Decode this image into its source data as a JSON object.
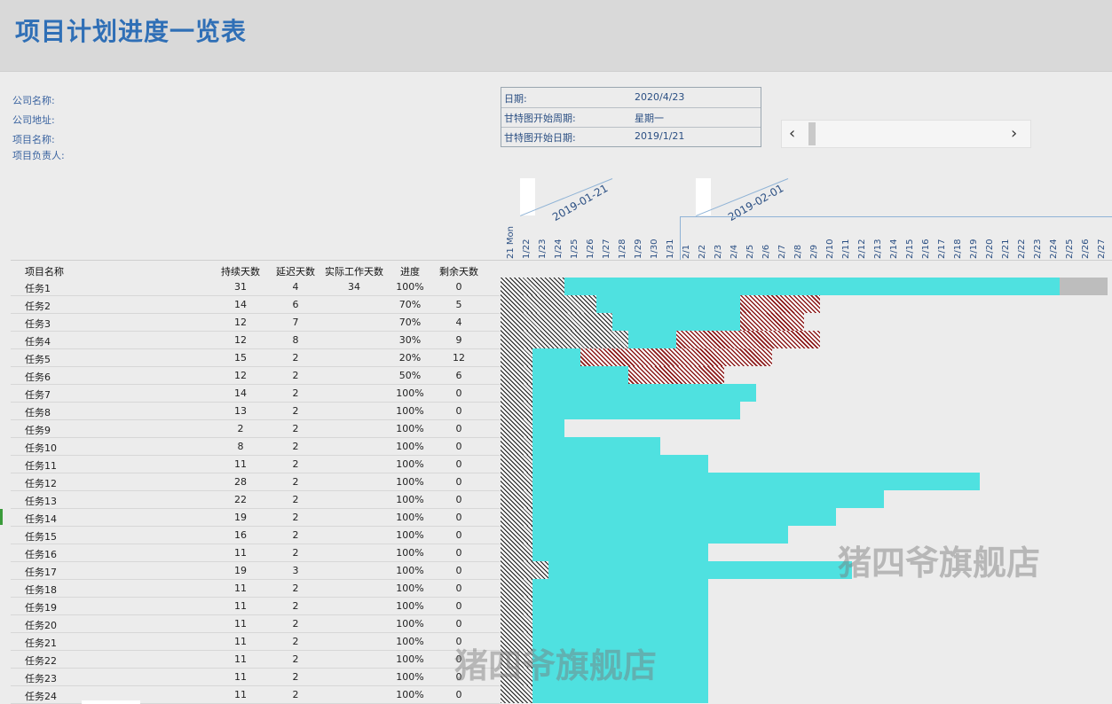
{
  "title": "项目计划进度一览表",
  "info": {
    "company_name_label": "公司名称:",
    "company_address_label": "公司地址:",
    "project_name_label": "项目名称:",
    "project_owner_label": "项目负责人:",
    "date_label": "日期:",
    "date_value": "2020/4/23",
    "gantt_start_week_label": "甘特图开始周期:",
    "gantt_start_week_value": "星期一",
    "gantt_start_date_label": "甘特图开始日期:",
    "gantt_start_date_value": "2019/1/21"
  },
  "scroller": {
    "prev_icon": "chevron-left-icon",
    "next_icon": "chevron-right-icon"
  },
  "months": [
    "2019-01-21",
    "2019-02-01"
  ],
  "days": [
    "21 Mon",
    "1/22",
    "1/23",
    "1/24",
    "1/25",
    "1/26",
    "1/27",
    "1/28",
    "1/29",
    "1/30",
    "1/31",
    "2/1",
    "2/2",
    "2/3",
    "2/4",
    "2/5",
    "2/6",
    "2/7",
    "2/8",
    "2/9",
    "2/10",
    "2/11",
    "2/12",
    "2/13",
    "2/14",
    "2/15",
    "2/16",
    "2/17",
    "2/18",
    "2/19",
    "2/20",
    "2/21",
    "2/22",
    "2/23",
    "2/24",
    "2/25",
    "2/26",
    "2/27"
  ],
  "columns": {
    "name": "项目名称",
    "duration": "持续天数",
    "delay": "延迟天数",
    "actual": "实际工作天数",
    "progress": "进度",
    "remaining": "剩余天数"
  },
  "tasks": [
    {
      "name": "任务1",
      "duration": "31",
      "delay": "4",
      "actual": "34",
      "progress": "100%",
      "remaining": "0"
    },
    {
      "name": "任务2",
      "duration": "14",
      "delay": "6",
      "actual": "",
      "progress": "70%",
      "remaining": "5"
    },
    {
      "name": "任务3",
      "duration": "12",
      "delay": "7",
      "actual": "",
      "progress": "70%",
      "remaining": "4"
    },
    {
      "name": "任务4",
      "duration": "12",
      "delay": "8",
      "actual": "",
      "progress": "30%",
      "remaining": "9"
    },
    {
      "name": "任务5",
      "duration": "15",
      "delay": "2",
      "actual": "",
      "progress": "20%",
      "remaining": "12"
    },
    {
      "name": "任务6",
      "duration": "12",
      "delay": "2",
      "actual": "",
      "progress": "50%",
      "remaining": "6"
    },
    {
      "name": "任务7",
      "duration": "14",
      "delay": "2",
      "actual": "",
      "progress": "100%",
      "remaining": "0"
    },
    {
      "name": "任务8",
      "duration": "13",
      "delay": "2",
      "actual": "",
      "progress": "100%",
      "remaining": "0"
    },
    {
      "name": "任务9",
      "duration": "2",
      "delay": "2",
      "actual": "",
      "progress": "100%",
      "remaining": "0"
    },
    {
      "name": "任务10",
      "duration": "8",
      "delay": "2",
      "actual": "",
      "progress": "100%",
      "remaining": "0"
    },
    {
      "name": "任务11",
      "duration": "11",
      "delay": "2",
      "actual": "",
      "progress": "100%",
      "remaining": "0"
    },
    {
      "name": "任务12",
      "duration": "28",
      "delay": "2",
      "actual": "",
      "progress": "100%",
      "remaining": "0"
    },
    {
      "name": "任务13",
      "duration": "22",
      "delay": "2",
      "actual": "",
      "progress": "100%",
      "remaining": "0"
    },
    {
      "name": "任务14",
      "duration": "19",
      "delay": "2",
      "actual": "",
      "progress": "100%",
      "remaining": "0"
    },
    {
      "name": "任务15",
      "duration": "16",
      "delay": "2",
      "actual": "",
      "progress": "100%",
      "remaining": "0"
    },
    {
      "name": "任务16",
      "duration": "11",
      "delay": "2",
      "actual": "",
      "progress": "100%",
      "remaining": "0"
    },
    {
      "name": "任务17",
      "duration": "19",
      "delay": "3",
      "actual": "",
      "progress": "100%",
      "remaining": "0"
    },
    {
      "name": "任务18",
      "duration": "11",
      "delay": "2",
      "actual": "",
      "progress": "100%",
      "remaining": "0"
    },
    {
      "name": "任务19",
      "duration": "11",
      "delay": "2",
      "actual": "",
      "progress": "100%",
      "remaining": "0"
    },
    {
      "name": "任务20",
      "duration": "11",
      "delay": "2",
      "actual": "",
      "progress": "100%",
      "remaining": "0"
    },
    {
      "name": "任务21",
      "duration": "11",
      "delay": "2",
      "actual": "",
      "progress": "100%",
      "remaining": "0"
    },
    {
      "name": "任务22",
      "duration": "11",
      "delay": "2",
      "actual": "",
      "progress": "100%",
      "remaining": "0"
    },
    {
      "name": "任务23",
      "duration": "11",
      "delay": "2",
      "actual": "",
      "progress": "100%",
      "remaining": "0"
    },
    {
      "name": "任务24",
      "duration": "11",
      "delay": "2",
      "actual": "",
      "progress": "100%",
      "remaining": "0"
    }
  ],
  "gantt": [
    {
      "hatch_days": 4,
      "done_days": 31,
      "delay_days": 0,
      "grey_days": 3
    },
    {
      "hatch_days": 6,
      "done_days": 9,
      "delay_days": 5,
      "grey_days": 0
    },
    {
      "hatch_days": 7,
      "done_days": 8,
      "delay_days": 4,
      "grey_days": 0
    },
    {
      "hatch_days": 8,
      "done_days": 3,
      "delay_days": 9,
      "grey_days": 0
    },
    {
      "hatch_days": 2,
      "done_days": 3,
      "delay_days": 12,
      "grey_days": 0
    },
    {
      "hatch_days": 2,
      "done_days": 6,
      "delay_days": 6,
      "grey_days": 0
    },
    {
      "hatch_days": 2,
      "done_days": 14,
      "delay_days": 0,
      "grey_days": 0
    },
    {
      "hatch_days": 2,
      "done_days": 13,
      "delay_days": 0,
      "grey_days": 0
    },
    {
      "hatch_days": 2,
      "done_days": 2,
      "delay_days": 0,
      "grey_days": 0
    },
    {
      "hatch_days": 2,
      "done_days": 8,
      "delay_days": 0,
      "grey_days": 0
    },
    {
      "hatch_days": 2,
      "done_days": 11,
      "delay_days": 0,
      "grey_days": 0
    },
    {
      "hatch_days": 2,
      "done_days": 28,
      "delay_days": 0,
      "grey_days": 0
    },
    {
      "hatch_days": 2,
      "done_days": 22,
      "delay_days": 0,
      "grey_days": 0
    },
    {
      "hatch_days": 2,
      "done_days": 19,
      "delay_days": 0,
      "grey_days": 0
    },
    {
      "hatch_days": 2,
      "done_days": 16,
      "delay_days": 0,
      "grey_days": 0
    },
    {
      "hatch_days": 2,
      "done_days": 11,
      "delay_days": 0,
      "grey_days": 0
    },
    {
      "hatch_days": 3,
      "done_days": 19,
      "delay_days": 0,
      "grey_days": 0
    },
    {
      "hatch_days": 2,
      "done_days": 11,
      "delay_days": 0,
      "grey_days": 0
    },
    {
      "hatch_days": 2,
      "done_days": 11,
      "delay_days": 0,
      "grey_days": 0
    },
    {
      "hatch_days": 2,
      "done_days": 11,
      "delay_days": 0,
      "grey_days": 0
    },
    {
      "hatch_days": 2,
      "done_days": 11,
      "delay_days": 0,
      "grey_days": 0
    },
    {
      "hatch_days": 2,
      "done_days": 11,
      "delay_days": 0,
      "grey_days": 0
    },
    {
      "hatch_days": 2,
      "done_days": 11,
      "delay_days": 0,
      "grey_days": 0
    },
    {
      "hatch_days": 2,
      "done_days": 11,
      "delay_days": 0,
      "grey_days": 0
    }
  ],
  "colors": {
    "done": "#4fe1e0",
    "delay": "#8b1a1a",
    "title": "#2f6fb6"
  },
  "watermark": "猪四爷旗舰店"
}
